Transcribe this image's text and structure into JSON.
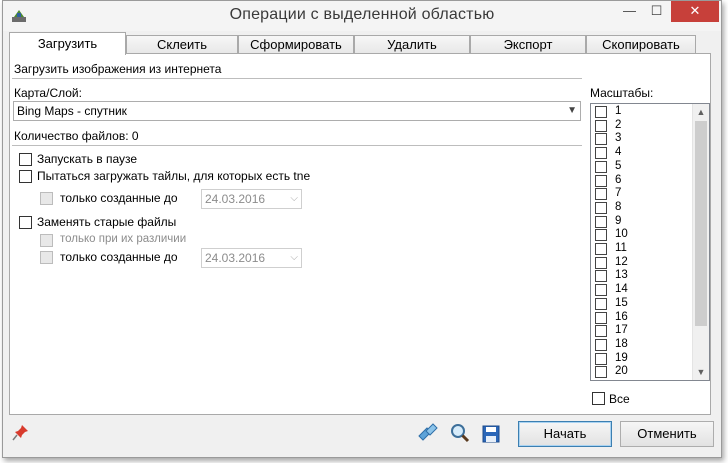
{
  "window": {
    "title": "Операции с выделенной областью"
  },
  "titlebar": {
    "min_glyph": "—",
    "max_glyph": "☐",
    "close_glyph": "✕"
  },
  "tabs": [
    {
      "label": "Загрузить",
      "active": true
    },
    {
      "label": "Склеить",
      "active": false
    },
    {
      "label": "Сформировать",
      "active": false
    },
    {
      "label": "Удалить",
      "active": false
    },
    {
      "label": "Экспорт",
      "active": false
    },
    {
      "label": "Скопировать",
      "active": false
    }
  ],
  "panel": {
    "heading": "Загрузить изображения из интернета",
    "map_layer_label": "Карта/Слой:",
    "map_layer_value": "Bing Maps - спутник",
    "file_count_label": "Количество файлов: 0",
    "options": {
      "start_paused": {
        "label": "Запускать в паузе",
        "checked": false
      },
      "try_load_tne": {
        "label": "Пытаться загружать тайлы, для которых есть tne",
        "checked": false
      },
      "only_created_before_1": {
        "label": "только созданные до",
        "date": "24.03.2016",
        "enabled": false
      },
      "replace_old": {
        "label": "Заменять старые файлы",
        "checked": false
      },
      "only_if_different": {
        "label": "только при их различии",
        "enabled": false
      },
      "only_created_before_2": {
        "label": "только созданные до",
        "date": "24.03.2016",
        "enabled": false
      }
    }
  },
  "scales": {
    "label": "Масштабы:",
    "items": [
      "1",
      "2",
      "3",
      "4",
      "5",
      "6",
      "7",
      "8",
      "9",
      "10",
      "11",
      "12",
      "13",
      "14",
      "15",
      "16",
      "17",
      "18",
      "19",
      "20"
    ],
    "all_label": "Все"
  },
  "footer": {
    "start_label": "Начать",
    "cancel_label": "Отменить"
  },
  "icons": {
    "pin": "pin-icon",
    "tiles": "tiles-icon",
    "search": "magnifier-icon",
    "save": "floppy-disk-icon"
  },
  "colors": {
    "close_button": "#c7403a",
    "accent_border": "#3c7fb1"
  }
}
